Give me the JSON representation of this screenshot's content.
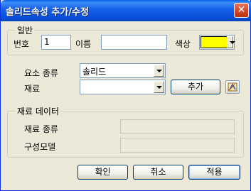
{
  "window": {
    "title": "솔리드속성 추가/수정",
    "close_glyph": "✕"
  },
  "general": {
    "legend": "일반",
    "number_label": "번호",
    "number_value": "1",
    "name_label": "이름",
    "name_value": "",
    "color_label": "색상",
    "color_value": "#ffff00"
  },
  "element": {
    "type_label": "요소 종류",
    "type_value": "솔리드",
    "material_label": "재료",
    "material_value": "",
    "add_button": "추가",
    "material_icon": "material-editor-icon"
  },
  "material_data": {
    "legend": "재료 데이터",
    "type_label": "재료 종류",
    "type_value": "",
    "model_label": "구성모델",
    "model_value": ""
  },
  "footer": {
    "ok": "확인",
    "cancel": "취소",
    "apply": "적용"
  }
}
